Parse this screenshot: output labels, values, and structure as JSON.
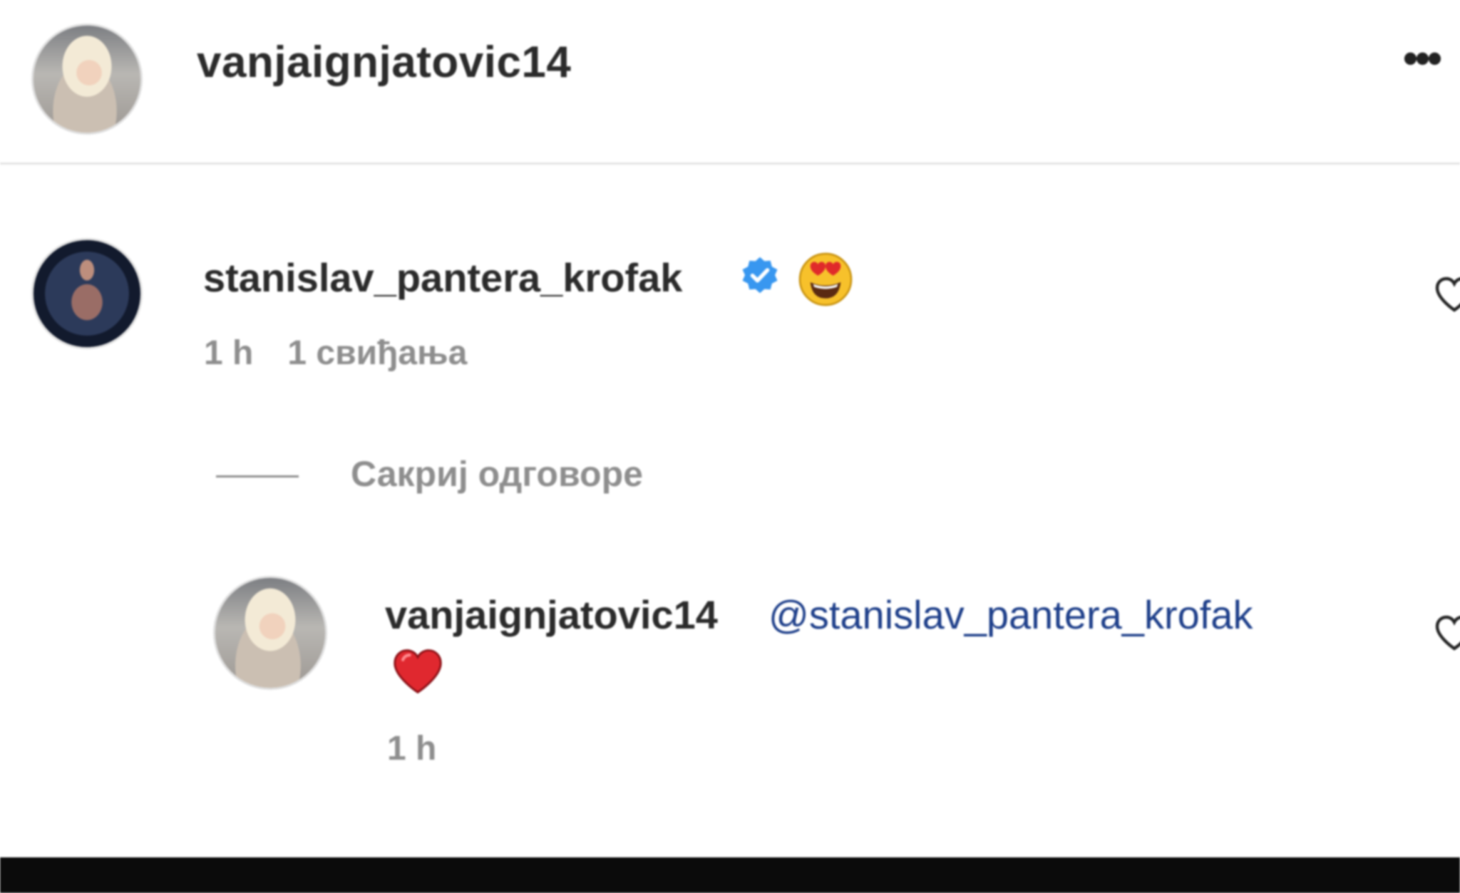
{
  "header": {
    "username": "vanjaignjatovic14",
    "more_label": "•••"
  },
  "comment": {
    "username": "stanislav_pantera_krofak",
    "verified": true,
    "emoji": "smiling-face-with-heart-eyes",
    "time": "1 h",
    "likes": "1 свиђања"
  },
  "replies_toggle": {
    "label": "Сакриј одговоре"
  },
  "reply": {
    "username": "vanjaignjatovic14",
    "mention": "@stanislav_pantera_krofak",
    "emoji": "red-heart",
    "time": "1 h"
  },
  "colors": {
    "verified_blue": "#3897f0",
    "mention_blue": "#1e3f8a",
    "meta_gray": "#8e8e8e",
    "heart_red": "#e0282f"
  }
}
